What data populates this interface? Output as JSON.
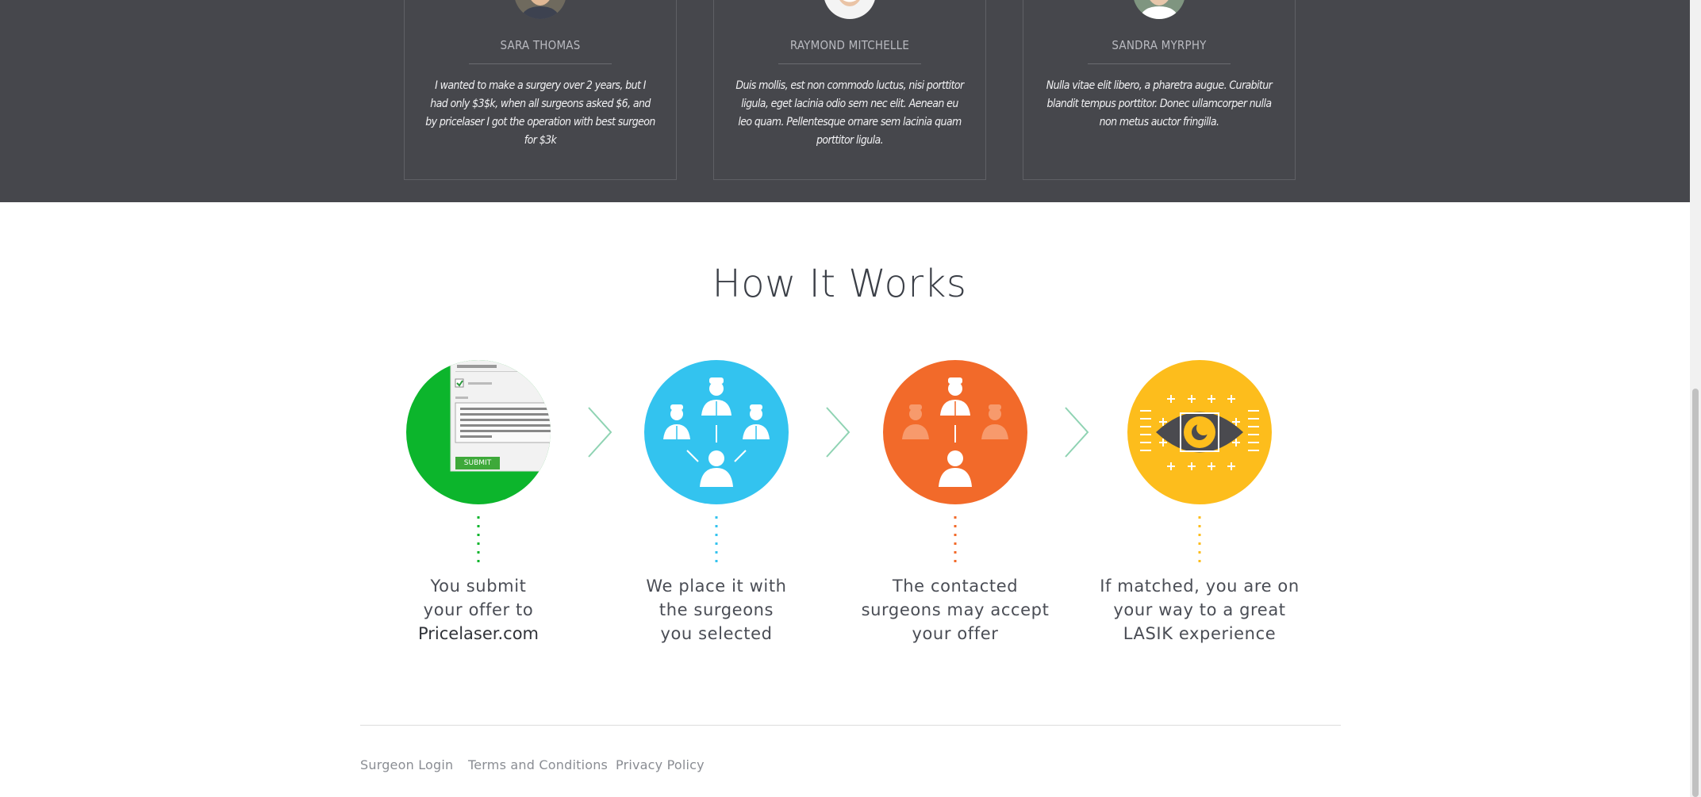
{
  "testimonials": [
    {
      "name": "SARA THOMAS",
      "quote": "I wanted to make a surgery over 2 years, but I had only $3$k, when all surgeons asked $6, and by pricelaser I got the operation with best surgeon for $3k"
    },
    {
      "name": "RAYMOND MITCHELLE",
      "quote": "Duis mollis, est non commodo luctus, nisi porttitor ligula, eget lacinia odio sem nec elit. Aenean eu leo quam. Pellentesque ornare sem lacinia quam porttitor ligula."
    },
    {
      "name": "SANDRA MYRPHY",
      "quote": "Nulla vitae elit libero, a pharetra augue. Curabitur blandit tempus porttitor. Donec ullamcorper nulla non metus auctor fringilla."
    }
  ],
  "how_it_works": {
    "title": "How It Works",
    "submit_label": "SUBMIT",
    "steps": [
      {
        "icon": "form-submit-icon",
        "color": "#0cb52c",
        "line1": "You submit",
        "line2": "your offer to",
        "line3": "Pricelaser.com"
      },
      {
        "icon": "surgeons-network-icon",
        "color": "#33c3ef",
        "line1": "We place it with",
        "line2": "the surgeons",
        "line3": "you selected"
      },
      {
        "icon": "surgeon-accept-icon",
        "color": "#f26a2a",
        "line1": "The contacted",
        "line2": "surgeons may accept",
        "line3": "your offer"
      },
      {
        "icon": "eye-target-icon",
        "color": "#fdbd1c",
        "line1": "If matched, you are on",
        "line2": "your way to a great",
        "line3": "LASIK experience"
      }
    ],
    "arrow_color": "#8fd3b3"
  },
  "footer": {
    "links": [
      "Surgeon Login",
      "Terms and Conditions",
      "Privacy Policy"
    ]
  },
  "colors": {
    "band": "#46474c",
    "heading": "#3b3f47"
  }
}
